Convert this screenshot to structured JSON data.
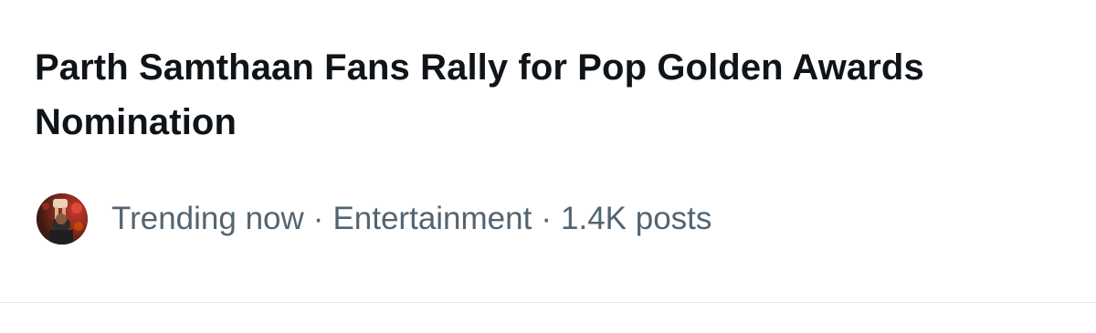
{
  "trend": {
    "title": "Parth Samthaan Fans Rally for Pop Golden Awards Nomination",
    "status": "Trending now",
    "category": "Entertainment",
    "post_count": "1.4K posts",
    "separator": "·"
  },
  "avatar": {
    "icon": "profile-avatar",
    "background": "#5a2a1e"
  },
  "colors": {
    "title": "#0f1419",
    "meta": "#536471",
    "divider": "#e3e6e8"
  }
}
